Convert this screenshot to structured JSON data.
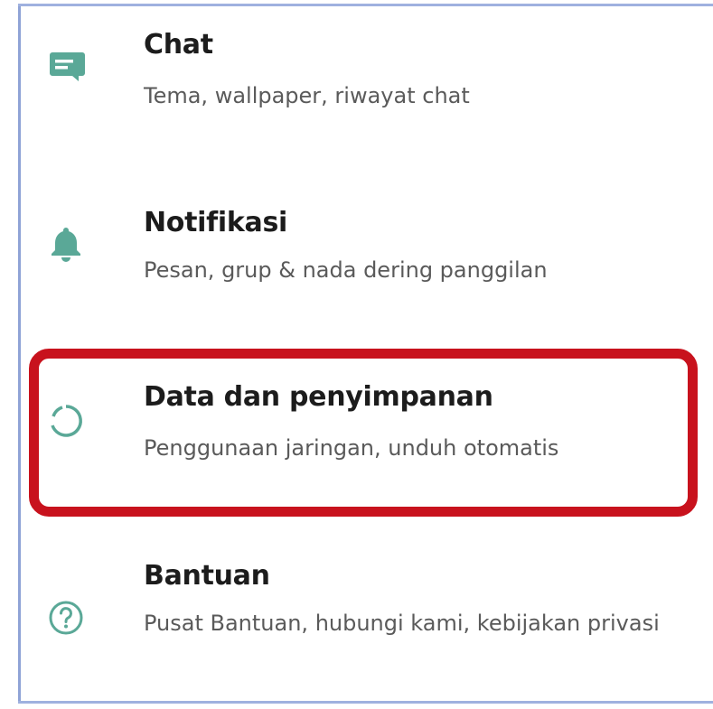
{
  "settings": {
    "items": [
      {
        "id": "chat",
        "icon": "chat-bubble-icon",
        "title": "Chat",
        "subtitle": "Tema, wallpaper, riwayat chat"
      },
      {
        "id": "notifications",
        "icon": "bell-icon",
        "title": "Notifikasi",
        "subtitle": "Pesan, grup & nada dering panggilan"
      },
      {
        "id": "data-storage",
        "icon": "data-usage-circle-icon",
        "title": "Data dan penyimpanan",
        "subtitle": "Penggunaan jaringan, unduh otomatis"
      },
      {
        "id": "help",
        "icon": "help-question-icon",
        "title": "Bantuan",
        "subtitle": "Pusat Bantuan, hubungi kami, kebijakan privasi"
      }
    ],
    "highlighted_item": "data-storage"
  },
  "colors": {
    "icon_accent": "#5aa897",
    "highlight_border": "#c8121d",
    "title_text": "#1c1c1c",
    "subtitle_text": "#5a5a5a",
    "frame_border": "#9fb1df"
  }
}
